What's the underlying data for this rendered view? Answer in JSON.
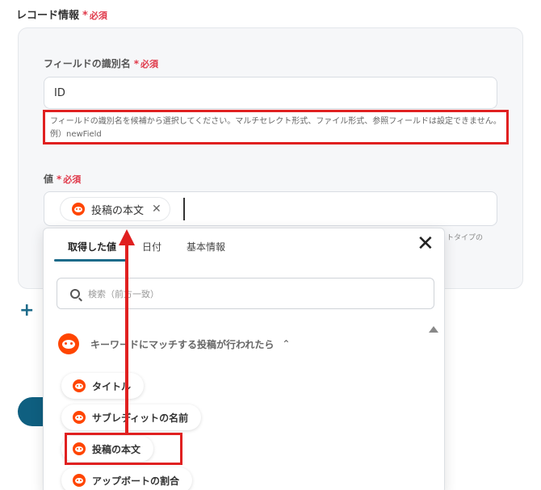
{
  "record_section": {
    "title": "レコード情報",
    "required_star": "*",
    "required_text": "必須"
  },
  "field_id": {
    "label": "フィールドの識別名",
    "required_star": "*",
    "required_text": "必須",
    "value": "ID",
    "help_text": "フィールドの識別名を候補から選択してください。マルチセレクト形式、ファイル形式、参照フィールドは設定できません。例）newField"
  },
  "field_value": {
    "label": "値",
    "required_star": "*",
    "required_text": "必須",
    "chip_label": "投稿の本文",
    "chip_remove": "✕",
    "trailing_help": "トタイプの"
  },
  "add_button": {
    "label": "+"
  },
  "dropdown": {
    "tabs": [
      "取得した値",
      "日付",
      "基本情報"
    ],
    "active_tab": 0,
    "close_label": "✕",
    "search_placeholder": "検索（前方一致）",
    "group_label": "キーワードにマッチする投稿が行われたら",
    "group_chevron": "⌃",
    "items": [
      "タイトル",
      "サブレディットの名前",
      "投稿の本文",
      "アップボートの割合"
    ]
  },
  "colors": {
    "accent": "#1d6b8a",
    "required": "#e0394a",
    "highlight": "#e02020",
    "reddit": "#ff4500"
  }
}
